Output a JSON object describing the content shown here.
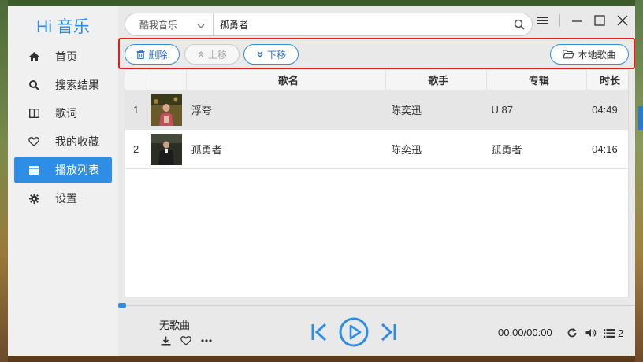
{
  "app": {
    "logo": "Hi 音乐"
  },
  "sidebar": {
    "items": [
      {
        "label": "首页",
        "icon": "home-icon"
      },
      {
        "label": "搜索结果",
        "icon": "search-icon"
      },
      {
        "label": "歌词",
        "icon": "lyrics-icon"
      },
      {
        "label": "我的收藏",
        "icon": "heart-icon"
      },
      {
        "label": "播放列表",
        "icon": "list-icon",
        "active": true
      },
      {
        "label": "设置",
        "icon": "gear-icon"
      }
    ]
  },
  "search": {
    "source": "酷我音乐",
    "query": "孤勇者"
  },
  "toolbar": {
    "delete_label": "删除",
    "up_label": "上移",
    "down_label": "下移",
    "local_label": "本地歌曲"
  },
  "table": {
    "headers": {
      "name": "歌名",
      "artist": "歌手",
      "album": "专辑",
      "time": "时长"
    },
    "rows": [
      {
        "index": "1",
        "name": "浮夸",
        "artist": "陈奕迅",
        "album": "U 87",
        "time": "04:49"
      },
      {
        "index": "2",
        "name": "孤勇者",
        "artist": "陈奕迅",
        "album": "孤勇者",
        "time": "04:16"
      }
    ]
  },
  "player": {
    "now_playing": "无歌曲",
    "time": "00:00/00:00",
    "playlist_count": "2",
    "progress": 0
  },
  "colors": {
    "accent": "#2e8ee6",
    "highlight": "#e02020"
  }
}
